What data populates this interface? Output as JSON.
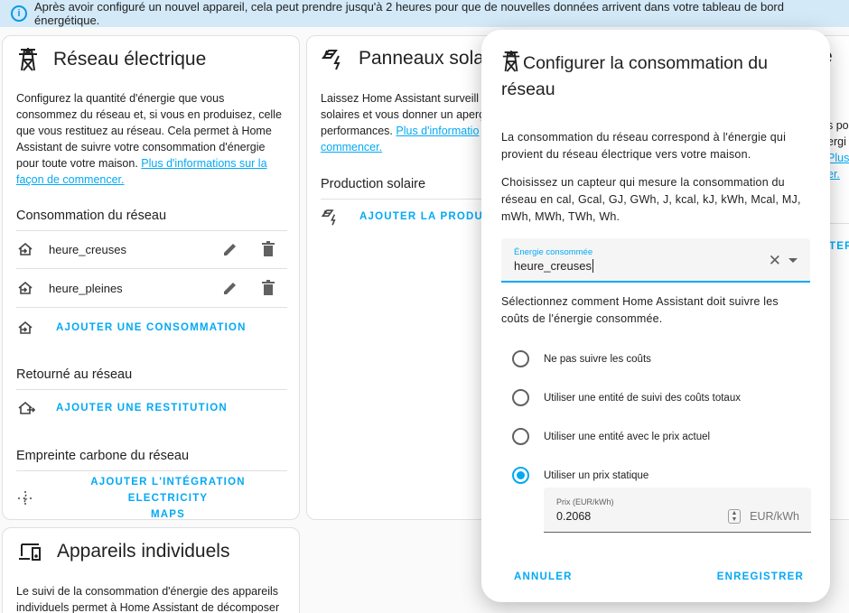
{
  "banner": {
    "text": "Après avoir configuré un nouvel appareil, cela peut prendre jusqu'à 2 heures pour que de nouvelles données arrivent dans votre tableau de bord énergétique.",
    "icon": "info-icon"
  },
  "grid_card": {
    "title": "Réseau électrique",
    "description": "Configurez la quantité d'énergie que vous consommez du réseau et, si vous en produisez, celle que vous restituez au réseau. Cela permet à Home Assistant de suivre votre consommation d'énergie pour toute votre maison.",
    "link": "Plus d'informations sur la façon de commencer.",
    "consumption_title": "Consommation du réseau",
    "consumption_items": [
      "heure_creuses",
      "heure_pleines"
    ],
    "add_consumption": "AJOUTER UNE CONSOMMATION",
    "return_title": "Retourné au réseau",
    "add_return": "AJOUTER UNE RESTITUTION",
    "carbon_title": "Empreinte carbone du réseau",
    "add_carbon_line1": "AJOUTER L'INTÉGRATION ELECTRICITY",
    "add_carbon_line2": "MAPS"
  },
  "solar_card": {
    "title": "Panneaux sola",
    "description_lines": [
      "Laissez Home Assistant surveill",
      "solaires et vous donner un aperç",
      "performances."
    ],
    "link_part1": "Plus d'informatio",
    "link_part2": "commencer.",
    "production_title": "Production solaire",
    "add_production": "AJOUTER LA PRODUCTI"
  },
  "right_peek": {
    "title_char": "e",
    "desc_lines": [
      "s po",
      "ergi"
    ],
    "link_lines": [
      "Plus",
      "er."
    ],
    "action": "TER"
  },
  "devices_card": {
    "title": "Appareils individuels",
    "description_lines": [
      "Le suivi de la consommation d'énergie des appareils",
      "individuels permet à Home Assistant de décomposer"
    ]
  },
  "dialog": {
    "title": "Configurer la consommation du réseau",
    "para1": "La consommation du réseau correspond à l'énergie qui provient du réseau électrique vers votre maison.",
    "para2": "Choisissez un capteur qui mesure la consommation du réseau en cal, Gcal, GJ, GWh, J, kcal, kJ, kWh, Mcal, MJ, mWh, MWh, TWh, Wh.",
    "field_label": "Énergie consommée",
    "field_value": "heure_creuses",
    "para3": "Sélectionnez comment Home Assistant doit suivre les coûts de l'énergie consommée.",
    "options": [
      "Ne pas suivre les coûts",
      "Utiliser une entité de suivi des coûts totaux",
      "Utiliser une entité avec le prix actuel",
      "Utiliser un prix statique"
    ],
    "selected_option_index": 3,
    "price_label": "Prix (EUR/kWh)",
    "price_value": "0.2068",
    "price_unit": "EUR/kWh",
    "cancel": "ANNULER",
    "save": "ENREGISTRER"
  },
  "colors": {
    "accent": "#03a9f4",
    "banner_bg": "#d3e9f7"
  }
}
